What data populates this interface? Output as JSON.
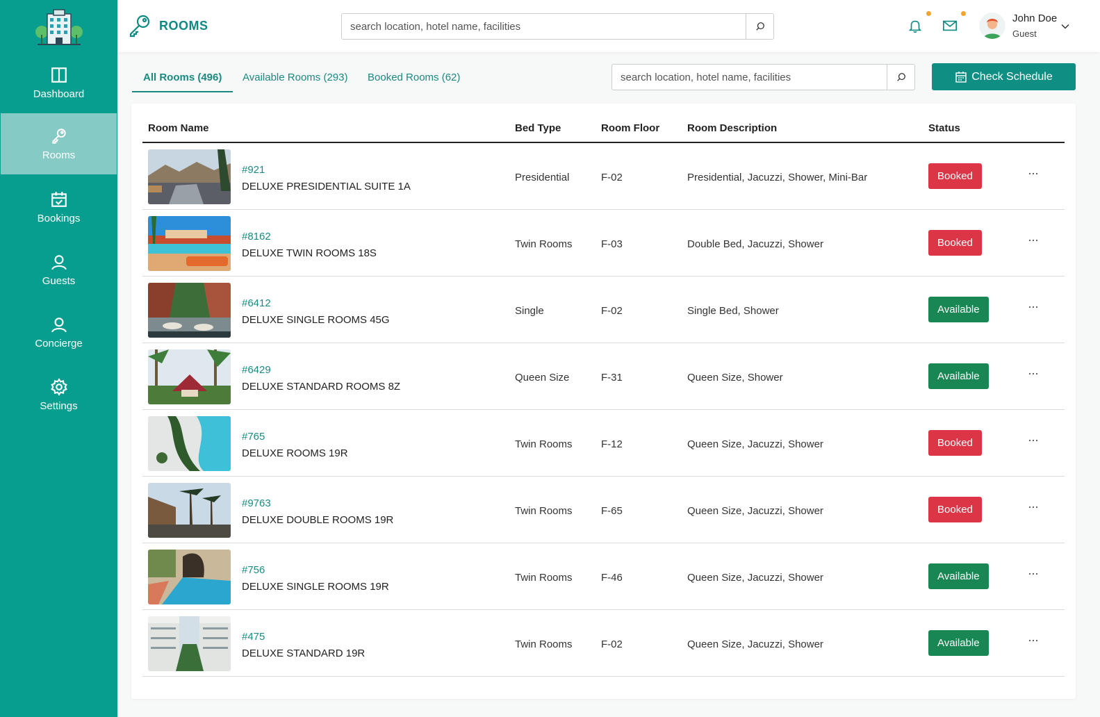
{
  "sidebar": {
    "items": [
      {
        "label": "Dashboard"
      },
      {
        "label": "Rooms"
      },
      {
        "label": "Bookings"
      },
      {
        "label": "Guests"
      },
      {
        "label": "Concierge"
      },
      {
        "label": "Settings"
      }
    ]
  },
  "header": {
    "title": "ROOMS",
    "search_placeholder": "search location, hotel name, facilities",
    "user_name": "John Doe",
    "user_role": "Guest"
  },
  "tabs": [
    {
      "label": "All Rooms (496)"
    },
    {
      "label": "Available Rooms (293)"
    },
    {
      "label": "Booked Rooms (62)"
    }
  ],
  "toolbar": {
    "search_placeholder": "search location, hotel name, facilities",
    "check_schedule_label": "Check Schedule"
  },
  "colors": {
    "brand": "#089e8f",
    "booked": "#dc3545",
    "available": "#198754"
  },
  "table": {
    "headers": [
      "Room Name",
      "Bed Type",
      "Room Floor",
      "Room Description",
      "Status"
    ],
    "rows": [
      {
        "id": "#921",
        "name": "DELUXE PRESIDENTIAL SUITE 1A",
        "bed": "Presidential",
        "floor": "F-02",
        "desc": "Presidential, Jacuzzi, Shower, Mini-Bar",
        "status": "Booked"
      },
      {
        "id": "#8162",
        "name": "DELUXE TWIN ROOMS 18S",
        "bed": "Twin Rooms",
        "floor": "F-03",
        "desc": "Double Bed, Jacuzzi, Shower",
        "status": "Booked"
      },
      {
        "id": "#6412",
        "name": "DELUXE SINGLE ROOMS 45G",
        "bed": "Single",
        "floor": "F-02",
        "desc": "Single Bed, Shower",
        "status": "Available"
      },
      {
        "id": "#6429",
        "name": "DELUXE STANDARD ROOMS 8Z",
        "bed": "Queen Size",
        "floor": "F-31",
        "desc": "Queen Size, Shower",
        "status": "Available"
      },
      {
        "id": "#765",
        "name": "DELUXE ROOMS 19R",
        "bed": "Twin Rooms",
        "floor": "F-12",
        "desc": "Queen Size, Jacuzzi, Shower",
        "status": "Booked"
      },
      {
        "id": "#9763",
        "name": "DELUXE DOUBLE ROOMS 19R",
        "bed": "Twin Rooms",
        "floor": "F-65",
        "desc": "Queen Size, Jacuzzi, Shower",
        "status": "Booked"
      },
      {
        "id": "#756",
        "name": "DELUXE SINGLE ROOMS 19R",
        "bed": "Twin Rooms",
        "floor": "F-46",
        "desc": "Queen Size, Jacuzzi, Shower",
        "status": "Available"
      },
      {
        "id": "#475",
        "name": "DELUXE STANDARD 19R",
        "bed": "Twin Rooms",
        "floor": "F-02",
        "desc": "Queen Size, Jacuzzi, Shower",
        "status": "Available"
      }
    ]
  }
}
